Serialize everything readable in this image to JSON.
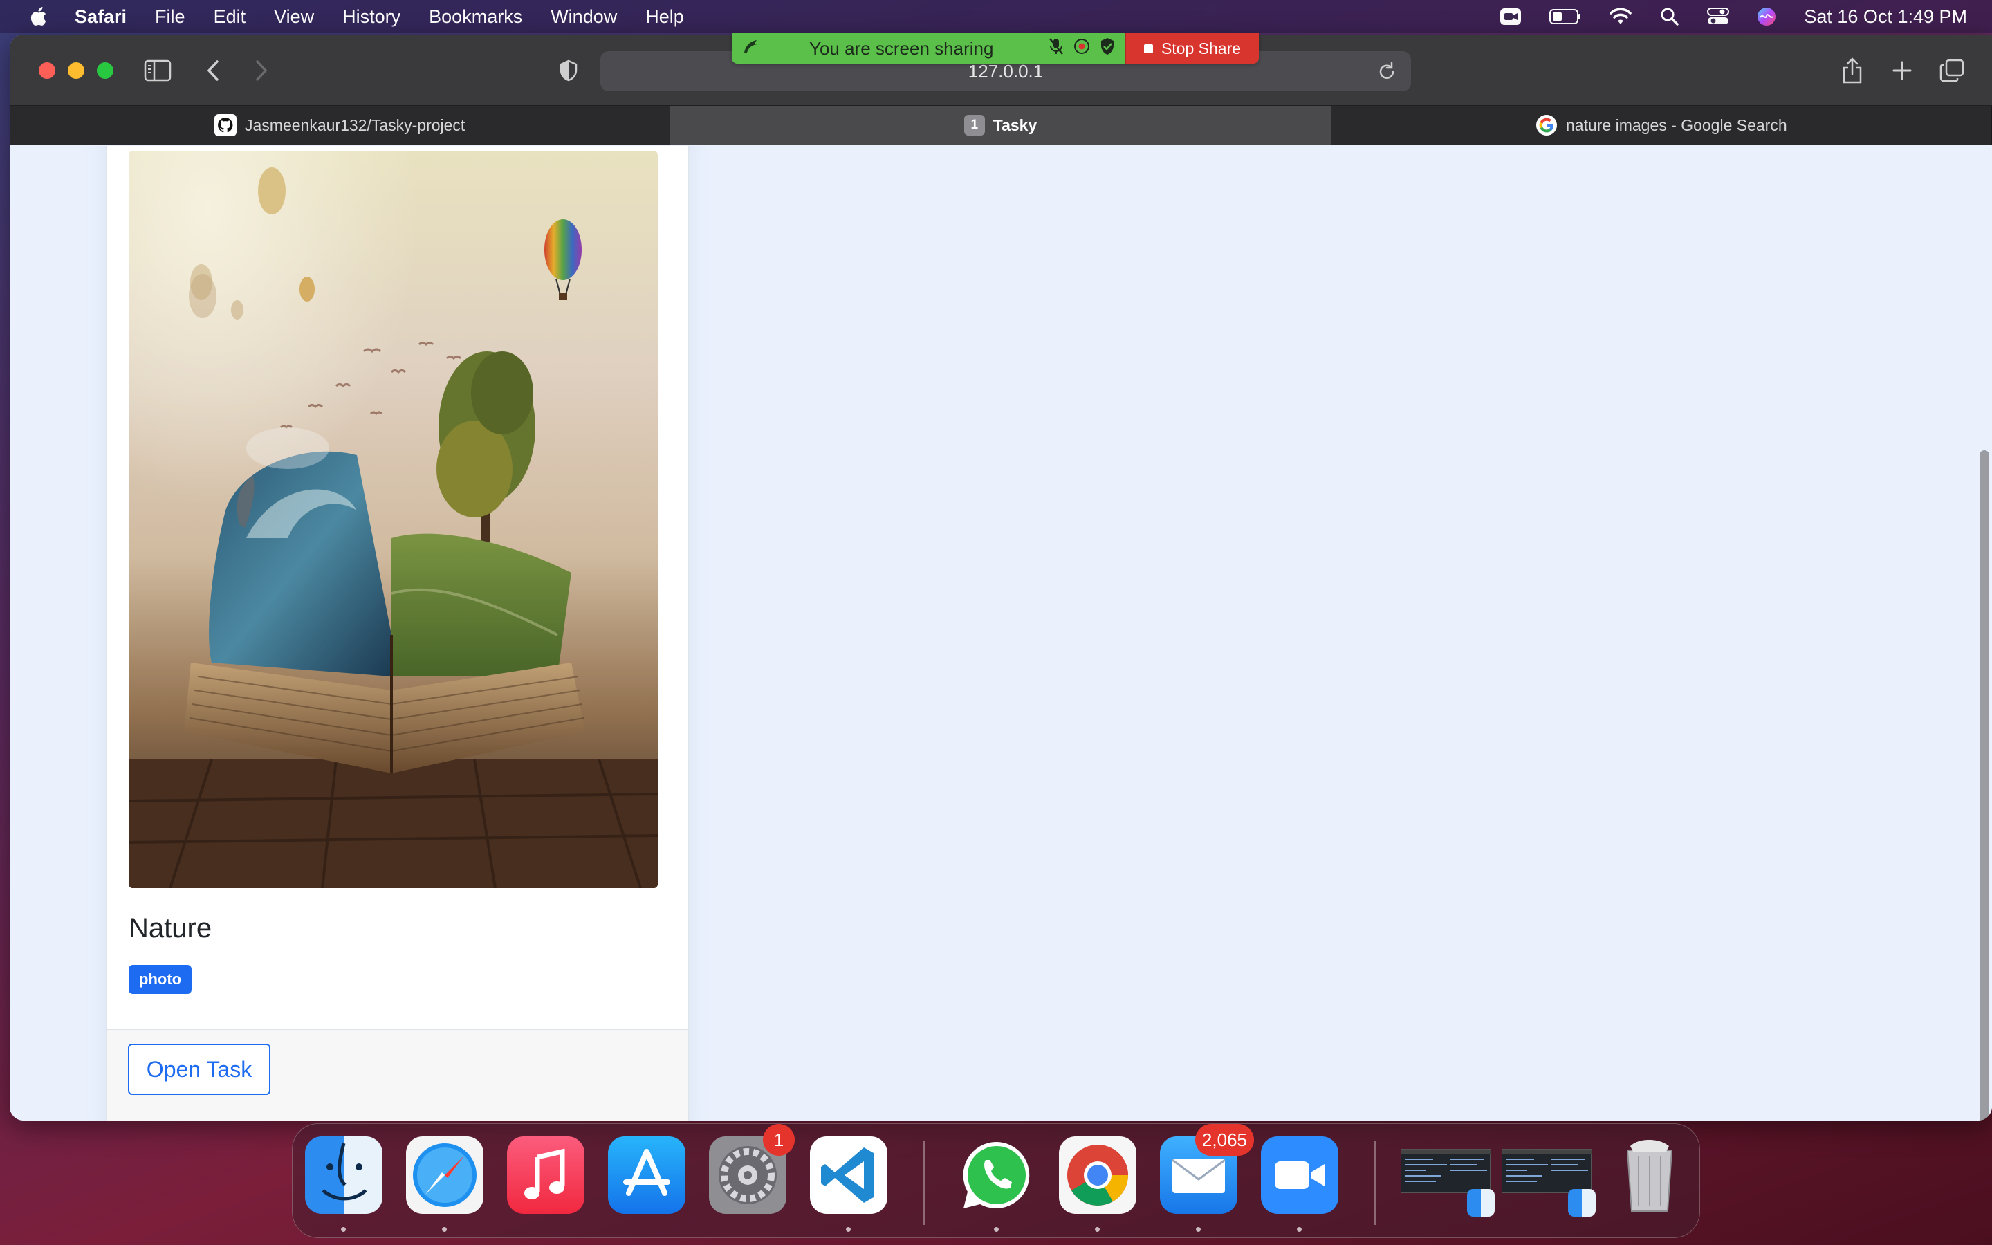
{
  "menubar": {
    "app_name": "Safari",
    "menus": [
      "File",
      "Edit",
      "View",
      "History",
      "Bookmarks",
      "Window",
      "Help"
    ],
    "clock": "Sat 16 Oct  1:49 PM"
  },
  "screen_share": {
    "status_text": "You are screen sharing",
    "stop_label": "Stop Share"
  },
  "browser": {
    "url": "127.0.0.1",
    "tabs": [
      {
        "label": "Jasmeenkaur132/Tasky-project",
        "active": false,
        "icon": "github-icon"
      },
      {
        "label": "Tasky",
        "active": true,
        "badge": "1"
      },
      {
        "label": "nature images - Google Search",
        "active": false,
        "icon": "google-icon"
      }
    ]
  },
  "card": {
    "title": "Nature",
    "tag": "photo",
    "open_button": "Open Task"
  },
  "dock": {
    "apps": [
      "Finder",
      "Safari",
      "Music",
      "App Store",
      "System Preferences",
      "Visual Studio Code",
      "WhatsApp",
      "Google Chrome",
      "Mail",
      "Zoom"
    ],
    "system_preferences_badge": "1",
    "mail_badge": "2,065"
  },
  "colors": {
    "accent": "#1d6bf0",
    "share_green": "#5bc04a",
    "share_red": "#d8352f",
    "page_bg": "#eaf1fd"
  }
}
